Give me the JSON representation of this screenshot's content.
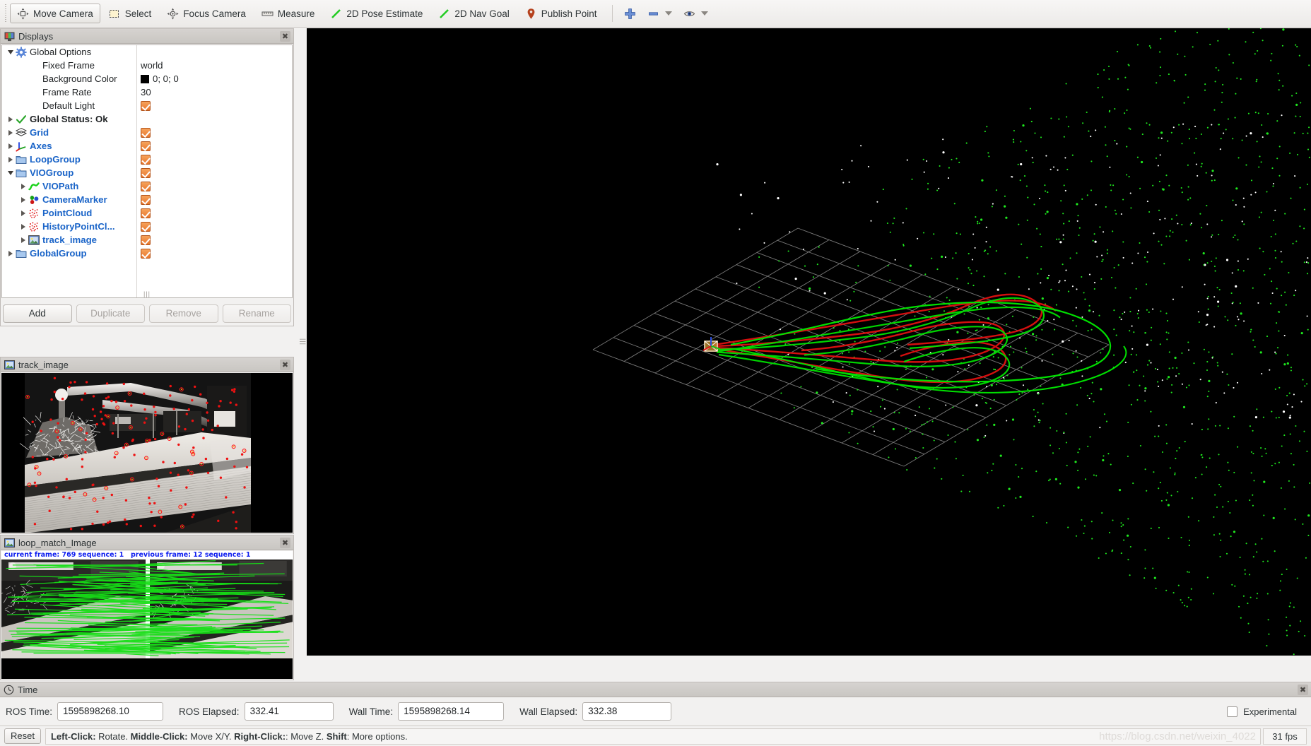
{
  "toolbar": {
    "items": [
      {
        "label": "Move Camera",
        "icon": "move-camera-icon",
        "active": true
      },
      {
        "label": "Select",
        "icon": "select-icon",
        "active": false
      },
      {
        "label": "Focus Camera",
        "icon": "focus-camera-icon",
        "active": false
      },
      {
        "label": "Measure",
        "icon": "measure-icon",
        "active": false
      },
      {
        "label": "2D Pose Estimate",
        "icon": "pose-estimate-icon",
        "active": false
      },
      {
        "label": "2D Nav Goal",
        "icon": "nav-goal-icon",
        "active": false
      },
      {
        "label": "Publish Point",
        "icon": "publish-point-icon",
        "active": false
      }
    ],
    "extra_icons": [
      "plus-icon",
      "minus-icon",
      "chevron-down-icon",
      "eye-icon",
      "chevron-down-icon"
    ]
  },
  "displays": {
    "title": "Displays",
    "title_icon": "display-monitor-icon",
    "close_icon": "close-icon",
    "tree": [
      {
        "label": "Global Options",
        "type": "group",
        "icon": "gear-icon",
        "expander": "down",
        "depth": 0,
        "value": null,
        "checkbox": false
      },
      {
        "label": "Fixed Frame",
        "type": "prop",
        "icon": null,
        "expander": null,
        "depth": 1,
        "value": "world",
        "checkbox": false
      },
      {
        "label": "Background Color",
        "type": "prop",
        "icon": null,
        "expander": null,
        "depth": 1,
        "value": "0; 0; 0",
        "swatch": "#000000",
        "checkbox": false
      },
      {
        "label": "Frame Rate",
        "type": "prop",
        "icon": null,
        "expander": null,
        "depth": 1,
        "value": "30",
        "checkbox": false
      },
      {
        "label": "Default Light",
        "type": "prop",
        "icon": null,
        "expander": null,
        "depth": 1,
        "value": null,
        "checkbox": true
      },
      {
        "label": "Global Status: Ok",
        "type": "status",
        "icon": "check-icon",
        "expander": "right",
        "depth": 0,
        "value": null,
        "checkbox": false
      },
      {
        "label": "Grid",
        "type": "item",
        "icon": "grid-icon",
        "expander": "right",
        "depth": 0,
        "value": null,
        "checkbox": true
      },
      {
        "label": "Axes",
        "type": "item",
        "icon": "axes-icon",
        "expander": "right",
        "depth": 0,
        "value": null,
        "checkbox": true
      },
      {
        "label": "LoopGroup",
        "type": "item",
        "icon": "folder-icon",
        "expander": "right",
        "depth": 0,
        "value": null,
        "checkbox": true
      },
      {
        "label": "VIOGroup",
        "type": "item",
        "icon": "folder-icon",
        "expander": "down",
        "depth": 0,
        "value": null,
        "checkbox": true
      },
      {
        "label": "VIOPath",
        "type": "item",
        "icon": "path-icon",
        "expander": "right",
        "depth": 1,
        "value": null,
        "checkbox": true
      },
      {
        "label": "CameraMarker",
        "type": "item",
        "icon": "marker-icon",
        "expander": "right",
        "depth": 1,
        "value": null,
        "checkbox": true
      },
      {
        "label": "PointCloud",
        "type": "item",
        "icon": "pointcloud-icon",
        "expander": "right",
        "depth": 1,
        "value": null,
        "checkbox": true
      },
      {
        "label": "HistoryPointCl...",
        "type": "item",
        "icon": "pointcloud-icon",
        "expander": "right",
        "depth": 1,
        "value": null,
        "checkbox": true
      },
      {
        "label": "track_image",
        "type": "item",
        "icon": "image-icon",
        "expander": "right",
        "depth": 1,
        "value": null,
        "checkbox": true
      },
      {
        "label": "GlobalGroup",
        "type": "item",
        "icon": "folder-icon",
        "expander": "right",
        "depth": 0,
        "value": null,
        "checkbox": true
      }
    ],
    "buttons": [
      {
        "label": "Add",
        "enabled": true
      },
      {
        "label": "Duplicate",
        "enabled": false
      },
      {
        "label": "Remove",
        "enabled": false
      },
      {
        "label": "Rename",
        "enabled": false
      }
    ]
  },
  "track_panel": {
    "title": "track_image",
    "title_icon": "image-icon",
    "close_icon": "close-icon"
  },
  "loop_panel": {
    "title": "loop_match_Image",
    "title_icon": "image-icon",
    "close_icon": "close-icon",
    "overlay_left": "current frame: 769   sequence: 1",
    "overlay_right": "previous frame: 12   sequence: 1"
  },
  "view3d": {
    "background_color": "#000000",
    "grid_color": "#a0a0a0",
    "vio_path_color": "#00e000",
    "loop_path_color": "#e01010",
    "pointcloud_color": "#1ee81e",
    "history_pointcloud_color": "#ffffff"
  },
  "time_panel": {
    "title": "Time",
    "title_icon": "clock-icon",
    "close_icon": "close-icon",
    "fields": [
      {
        "label": "ROS Time:",
        "value": "1595898268.10"
      },
      {
        "label": "ROS Elapsed:",
        "value": "332.41"
      },
      {
        "label": "Wall Time:",
        "value": "1595898268.14"
      },
      {
        "label": "Wall Elapsed:",
        "value": "332.38"
      }
    ],
    "experimental_label": "Experimental",
    "experimental_checked": false
  },
  "status_bar": {
    "reset_label": "Reset",
    "hint_parts": [
      {
        "text": "Left-Click:",
        "bold": true
      },
      {
        "text": " Rotate. ",
        "bold": false
      },
      {
        "text": "Middle-Click:",
        "bold": true
      },
      {
        "text": " Move X/Y. ",
        "bold": false
      },
      {
        "text": "Right-Click:",
        "bold": true
      },
      {
        "text": ": Move Z. ",
        "bold": false
      },
      {
        "text": "Shift",
        "bold": true
      },
      {
        "text": ": More options.",
        "bold": false
      }
    ],
    "fps": "31 fps",
    "watermark": "https://blog.csdn.net/weixin_4022"
  }
}
